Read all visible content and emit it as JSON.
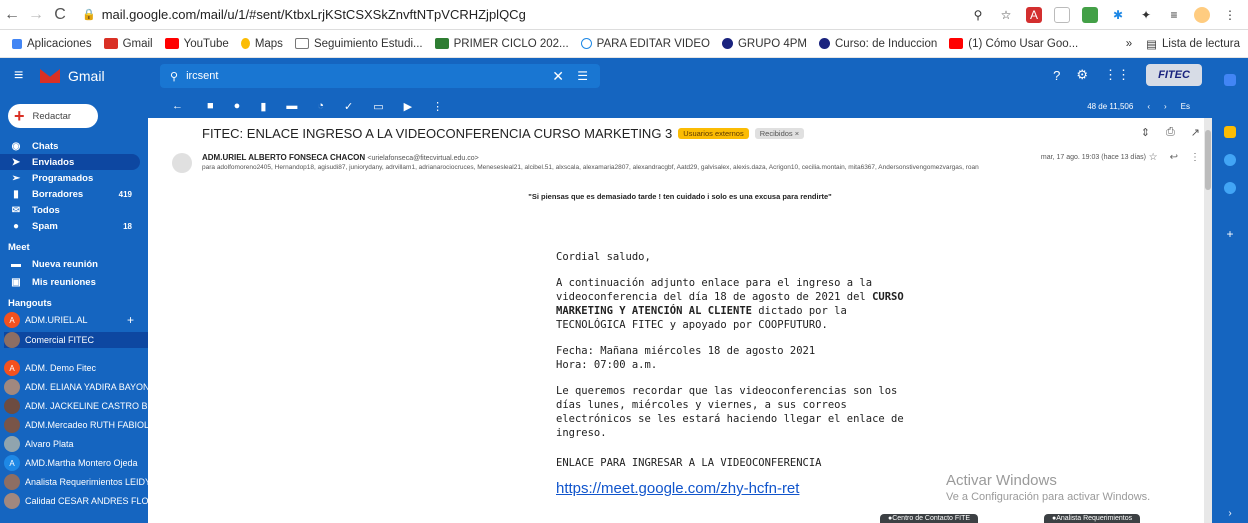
{
  "browser": {
    "url": "mail.google.com/mail/u/1/#sent/KtbxLrjKStCSXSkZnvftNTpVCRHZjplQCg",
    "bookmarks": [
      "Aplicaciones",
      "Gmail",
      "YouTube",
      "Maps",
      "Seguimiento Estudi...",
      "PRIMER CICLO 202...",
      "PARA EDITAR VIDEO",
      "GRUPO 4PM",
      "Curso: de Induccion",
      "(1) Cómo Usar Goo..."
    ],
    "bookmarks_more": "»",
    "reading_list": "Lista de lectura"
  },
  "header": {
    "app_name": "Gmail",
    "search_value": "ircsent",
    "account_initial": "A",
    "org_logo": "FITEC"
  },
  "sidebar": {
    "compose_label": "Redactar",
    "items": [
      {
        "label": "Chats",
        "count": ""
      },
      {
        "label": "Enviados",
        "count": ""
      },
      {
        "label": "Programados",
        "count": ""
      },
      {
        "label": "Borradores",
        "count": "419"
      },
      {
        "label": "Todos",
        "count": ""
      },
      {
        "label": "Spam",
        "count": "18"
      }
    ],
    "meet_title": "Meet",
    "meet_items": [
      "Nueva reunión",
      "Mis reuniones"
    ],
    "hangouts_title": "Hangouts",
    "hangouts": [
      {
        "name": "ADM.URIEL.AL",
        "initial": "A",
        "color": "#f4511e"
      },
      {
        "name": "Comercial FITEC",
        "initial": "",
        "color": "#8d6e63"
      },
      {
        "name": "ADM. Demo Fitec",
        "initial": "A",
        "color": "#f4511e"
      },
      {
        "name": "ADM. ELIANA YADIRA BAYON",
        "initial": "",
        "color": "#a1887f"
      },
      {
        "name": "ADM. JACKELINE CASTRO B",
        "initial": "",
        "color": "#6d4c41"
      },
      {
        "name": "ADM.Mercadeo RUTH FABIOL",
        "initial": "",
        "color": "#795548"
      },
      {
        "name": "Alvaro Plata",
        "initial": "",
        "color": "#90a4ae"
      },
      {
        "name": "AMD.Martha Montero Ojeda",
        "initial": "A",
        "color": "#1e88e5"
      },
      {
        "name": "Analista Requerimientos LEIDY",
        "initial": "",
        "color": "#8d6e63"
      },
      {
        "name": "Calidad CESAR ANDRES FLO",
        "initial": "",
        "color": "#a1887f"
      }
    ]
  },
  "toolbar": {
    "count": "48 de 11,506",
    "lang": "Es"
  },
  "email": {
    "subject": "FITEC: ENLACE INGRESO A LA VIDEOCONFERENCIA CURSO MARKETING 3",
    "label_external": "Usuarios externos",
    "label_inbox": "Recibidos ×",
    "sender_name": "ADM.URIEL ALBERTO FONSECA CHACON",
    "sender_email": "<urielafonseca@fitecvirtual.edu.co>",
    "recipients": "para adolfomoreno2405, Hernandop18, agisudi87, juniorydany, adrvillam1, adrianarociocruces, Menesesleal21, alcibel.51, alxscala, alexamaria2807, alexandracgbf, Aatd29, galvisalex, alexis.daza, Acrigon10, cecilia.montain, mita6367, Andersonstivengomezvargas, roan",
    "date": "mar, 17 ago. 19:03 (hace 13 días)",
    "quote": "\"Si piensas que es demasiado tarde ! ten cuidado i solo es una excusa para rendirte\"",
    "greeting": "Cordial  saludo,",
    "p1_a": "A continuación adjunto enlace para el ingreso a la videoconferencia del día 18 de agosto de 2021 del ",
    "p1_bold": "CURSO MARKETING Y ATENCIÓN AL CLIENTE",
    "p1_b": " dictado por la TECNOLÓGICA FITEC y apoyado por COOPFUTURO.",
    "fecha": "Fecha: Mañana miércoles 18 de agosto 2021",
    "hora": "Hora: 07:00 a.m.",
    "p2": "Le queremos recordar que las videoconferencias son los días lunes, miércoles y viernes, a sus correos electrónicos se les estará haciendo llegar el enlace de ingreso.",
    "enlace_title": "ENLACE PARA INGRESAR A LA VIDEOCONFERENCIA",
    "link": "https://meet.google.com/zhy-hcfn-ret"
  },
  "watermark": {
    "title": "Activar Windows",
    "subtitle": "Ve a Configuración para activar Windows."
  },
  "chats": [
    "Centro de Contacto FITE",
    "Analista Requerimientos"
  ]
}
